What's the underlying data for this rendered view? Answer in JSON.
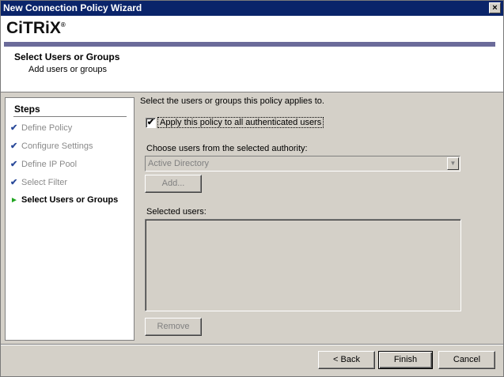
{
  "window": {
    "title": "New Connection Policy Wizard",
    "close_symbol": "×"
  },
  "header": {
    "logo_text": "CiTRiX",
    "logo_mark": "®",
    "title": "Select Users or Groups",
    "subtitle": "Add users or groups"
  },
  "steps": {
    "title": "Steps",
    "items": [
      {
        "label": "Define Policy",
        "status": "done"
      },
      {
        "label": "Configure Settings",
        "status": "done"
      },
      {
        "label": "Define IP Pool",
        "status": "done"
      },
      {
        "label": "Select Filter",
        "status": "done"
      },
      {
        "label": "Select Users or Groups",
        "status": "current"
      }
    ],
    "done_marker": "✔",
    "current_marker": "►"
  },
  "main": {
    "instruction": "Select  the users or groups this policy applies to.",
    "apply_all": {
      "label": "Apply this policy to all authenticated users",
      "checked": true,
      "check_mark": "✔"
    },
    "authority_label": "Choose users from the selected  authority:",
    "authority_select": {
      "value": "Active Directory",
      "arrow": "▼"
    },
    "add_button": "Add...",
    "selected_users_label": "Selected users:",
    "remove_button": "Remove"
  },
  "footer": {
    "back_button": "< Back",
    "finish_button": "Finish",
    "cancel_button": "Cancel"
  },
  "colors": {
    "titlebar": "#0a246a",
    "brand_bar": "#6b6b9a",
    "dialog_bg": "#d4d0c8",
    "step_check": "#2a4a9a",
    "current_arrow": "#21a521"
  }
}
